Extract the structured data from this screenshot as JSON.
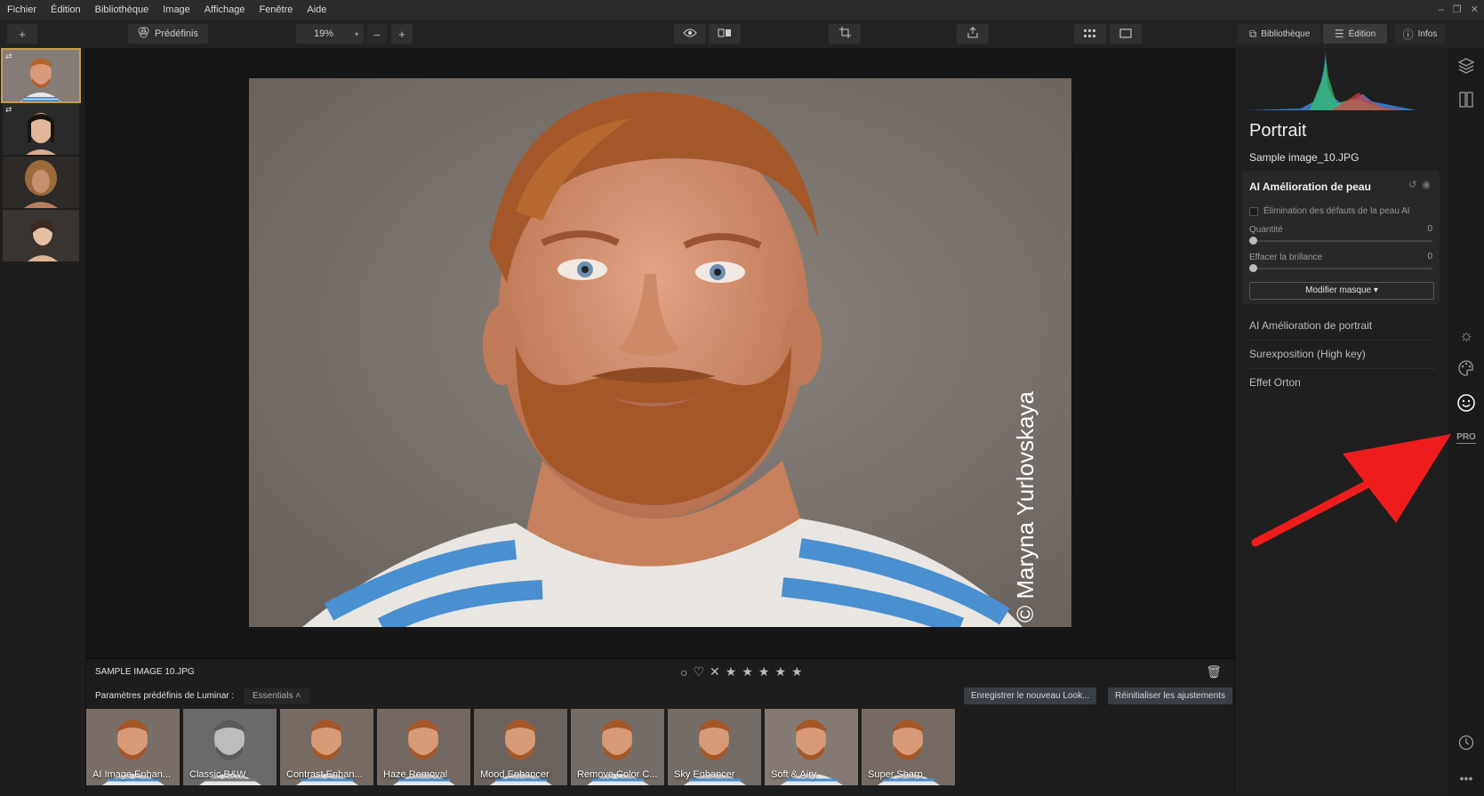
{
  "menubar": {
    "items": [
      "Fichier",
      "Édition",
      "Bibliothèque",
      "Image",
      "Affichage",
      "Fenêtre",
      "Aide"
    ],
    "window_controls": [
      "–",
      "❐",
      "✕"
    ]
  },
  "toolbar": {
    "add_icon": "+",
    "presets_label": "Prédéfinis",
    "zoom_value": "19%",
    "zoom_minus": "–",
    "zoom_plus": "+"
  },
  "topnav": {
    "library_label": "Bibliothèque",
    "edit_label": "Édition",
    "info_label": "Infos",
    "active": "edit"
  },
  "filmstrip": {
    "thumbnails": [
      {
        "name": "man-red-beard",
        "selected": true,
        "has_edits": true
      },
      {
        "name": "asian-woman",
        "selected": false,
        "has_edits": true
      },
      {
        "name": "woman-curly-hair",
        "selected": false,
        "has_edits": false
      },
      {
        "name": "smiling-woman",
        "selected": false,
        "has_edits": false
      }
    ]
  },
  "main_image": {
    "watermark": "© Maryna Yurlovskaya"
  },
  "infobar": {
    "filename": "SAMPLE IMAGE 10.JPG",
    "stars": 5
  },
  "presets": {
    "label": "Paramètres prédéfinis de Luminar :",
    "category": "Essentials",
    "save_look": "Enregistrer le nouveau Look...",
    "reset": "Réinitialiser les ajustements",
    "items": [
      {
        "label": "AI Image Enhan...",
        "tint": "#7a6f68"
      },
      {
        "label": "Classic B&W",
        "tint": "#6a6a6a"
      },
      {
        "label": "Contrast Enhan...",
        "tint": "#776b64"
      },
      {
        "label": "Haze Removal",
        "tint": "#736861"
      },
      {
        "label": "Mood Enhancer",
        "tint": "#6b625d"
      },
      {
        "label": "Remove Color C...",
        "tint": "#756d68"
      },
      {
        "label": "Sky Enhancer",
        "tint": "#746c66"
      },
      {
        "label": "Soft & Airy",
        "tint": "#857a73"
      },
      {
        "label": "Super Sharp",
        "tint": "#766b64"
      }
    ]
  },
  "panel": {
    "title": "Portrait",
    "subtitle": "Sample image_10.JPG",
    "tool_card": {
      "title": "AI Amélioration de peau",
      "checkbox_label": "Élimination des défauts de la peau AI",
      "sliders": [
        {
          "label": "Quantité",
          "value": "0"
        },
        {
          "label": "Effacer la brillance",
          "value": "0"
        }
      ],
      "mask_button": "Modifier masque ▾"
    },
    "tools": [
      "AI Amélioration de portrait",
      "Surexposition (High key)",
      "Effet Orton"
    ]
  },
  "rail": {
    "icons": [
      "layers-icon",
      "canvas-icon",
      "sun-icon",
      "palette-icon",
      "face-icon",
      "pro-icon",
      "history-icon",
      "more-icon"
    ],
    "pro_label": "PRO"
  },
  "colors": {
    "accent_selected": "#c99a4a",
    "annotation_arrow": "#ee1c1c",
    "stripe_blue": "#4a8fd0"
  }
}
